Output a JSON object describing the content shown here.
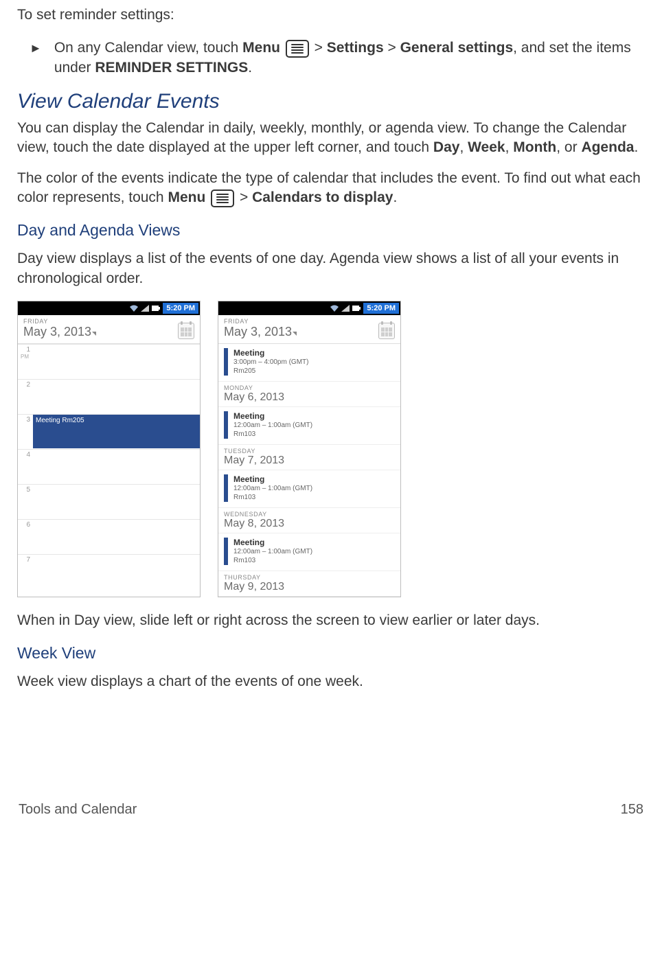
{
  "intro": "To set reminder settings:",
  "bullet": {
    "pre": "On any Calendar view, touch ",
    "menu": "Menu",
    "gt1": " > ",
    "settings": "Settings",
    "gt2": " > ",
    "general": "General settings",
    "after": ", and set the items under ",
    "reminder": "REMINDER SETTINGS",
    "period": "."
  },
  "h1": "View Calendar Events",
  "p1": {
    "a": "You can display the Calendar in daily, weekly, monthly, or agenda view. To change the Calendar view, touch the date displayed at the upper left corner, and touch ",
    "day": "Day",
    "c1": ", ",
    "week": "Week",
    "c2": ", ",
    "month": "Month",
    "c3": ", or ",
    "agenda": "Agenda",
    "end": "."
  },
  "p2": {
    "a": "The color of the events indicate the type of calendar that includes the event. To find out what each color represents, touch ",
    "menu": "Menu",
    "gt": " > ",
    "ctd": "Calendars to display",
    "end": "."
  },
  "h2a": "Day and Agenda Views",
  "p3": "Day view displays a list of the events of one day. Agenda view shows a list of all your events in chronological order.",
  "status_time": "5:20 PM",
  "dayview": {
    "weekday": "FRIDAY",
    "date": "May 3, 2013",
    "hours": [
      "1",
      "2",
      "3",
      "4",
      "5",
      "6",
      "7"
    ],
    "pm": "PM",
    "event": "Meeting Rm205"
  },
  "agendaview": {
    "weekday": "FRIDAY",
    "date": "May 3, 2013",
    "sections": [
      {
        "wd": "",
        "date": "",
        "title": "Meeting",
        "time": "3:00pm – 4:00pm (GMT)",
        "loc": "Rm205"
      },
      {
        "wd": "MONDAY",
        "date": "May 6, 2013",
        "title": "Meeting",
        "time": "12:00am – 1:00am (GMT)",
        "loc": "Rm103"
      },
      {
        "wd": "TUESDAY",
        "date": "May 7, 2013",
        "title": "Meeting",
        "time": "12:00am – 1:00am (GMT)",
        "loc": "Rm103"
      },
      {
        "wd": "WEDNESDAY",
        "date": "May 8, 2013",
        "title": "Meeting",
        "time": "12:00am – 1:00am (GMT)",
        "loc": "Rm103"
      },
      {
        "wd": "THURSDAY",
        "date": "May 9, 2013",
        "title": "",
        "time": "",
        "loc": ""
      }
    ]
  },
  "p4": "When in Day view, slide left or right across the screen to view earlier or later days.",
  "h2b": "Week View",
  "p5": "Week view displays a chart of the events of one week.",
  "footer": {
    "left": "Tools and Calendar",
    "page": "158"
  }
}
